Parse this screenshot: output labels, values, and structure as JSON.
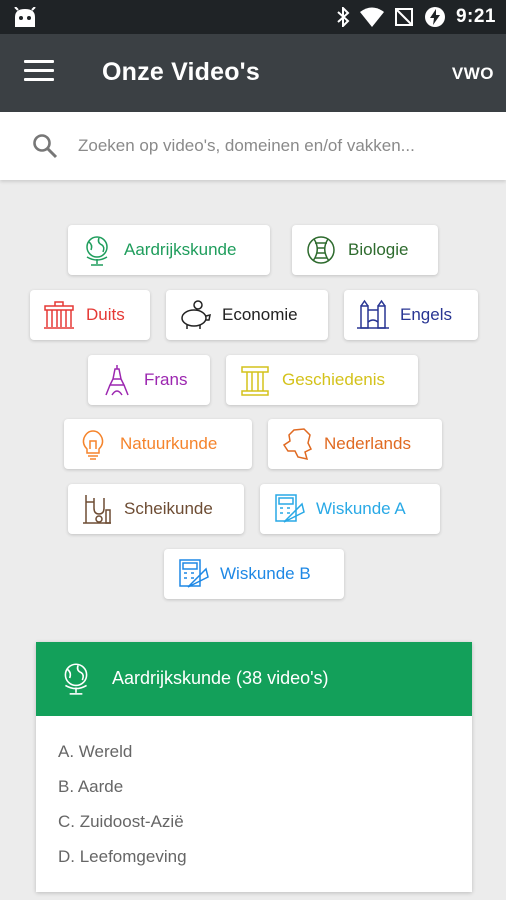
{
  "status_bar": {
    "time": "9:21"
  },
  "toolbar": {
    "title": "Onze Video's",
    "level": "VWO"
  },
  "search": {
    "placeholder": "Zoeken op video's, domeinen en/of vakken...",
    "value": ""
  },
  "subjects": [
    {
      "label": "Aardrijkskunde",
      "color": "#1f9d5c",
      "icon": "globe-icon"
    },
    {
      "label": "Biologie",
      "color": "#2e6b2e",
      "icon": "dna-icon"
    },
    {
      "label": "Duits",
      "color": "#e53935",
      "icon": "brandenburg-gate-icon"
    },
    {
      "label": "Economie",
      "color": "#222222",
      "icon": "piggy-bank-icon"
    },
    {
      "label": "Engels",
      "color": "#283593",
      "icon": "tower-bridge-icon"
    },
    {
      "label": "Frans",
      "color": "#9c27b0",
      "icon": "eiffel-tower-icon"
    },
    {
      "label": "Geschiedenis",
      "color": "#d4c21b",
      "icon": "column-icon"
    },
    {
      "label": "Natuurkunde",
      "color": "#f5842c",
      "icon": "lightbulb-icon"
    },
    {
      "label": "Nederlands",
      "color": "#e06a22",
      "icon": "netherlands-map-icon"
    },
    {
      "label": "Scheikunde",
      "color": "#6d4c33",
      "icon": "lab-flask-icon"
    },
    {
      "label": "Wiskunde A",
      "color": "#29a9e6",
      "icon": "calculator-icon"
    },
    {
      "label": "Wiskunde B",
      "color": "#1e88e5",
      "icon": "calculator-icon"
    }
  ],
  "card": {
    "title": "Aardrijkskunde (38 video's)",
    "header_color": "#13a05a",
    "icon": "globe-icon",
    "items": [
      "A. Wereld",
      "B. Aarde",
      "C. Zuidoost-Azië",
      "D. Leefomgeving"
    ]
  }
}
